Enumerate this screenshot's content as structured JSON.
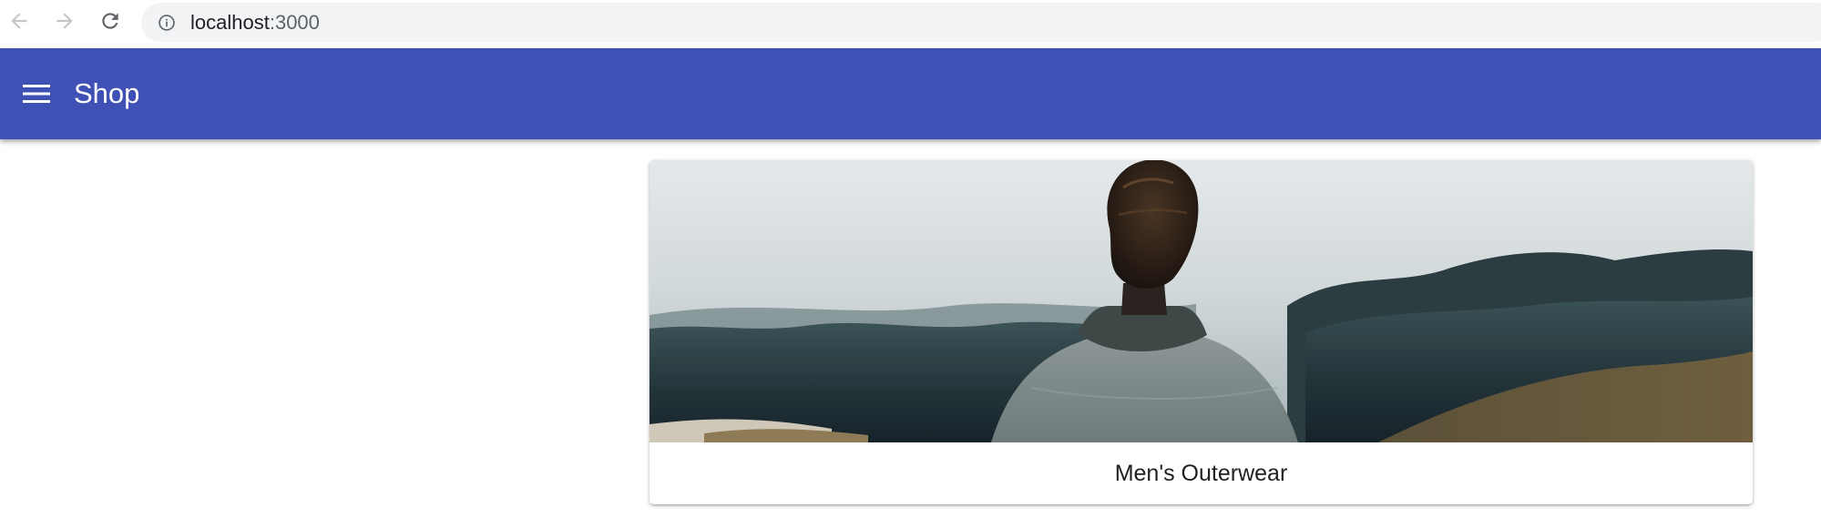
{
  "browser": {
    "url_host": "localhost",
    "url_port": ":3000",
    "icons": {
      "back": "arrow-left-icon",
      "forward": "arrow-right-icon",
      "reload": "reload-icon",
      "info": "info-circle-icon"
    }
  },
  "app_bar": {
    "title": "Shop",
    "menu_icon": "hamburger-menu-icon",
    "color": "#3f51b5"
  },
  "categories": [
    {
      "title": "Men's Outerwear",
      "image": "man-in-grey-sweater-facing-foggy-hills"
    }
  ]
}
